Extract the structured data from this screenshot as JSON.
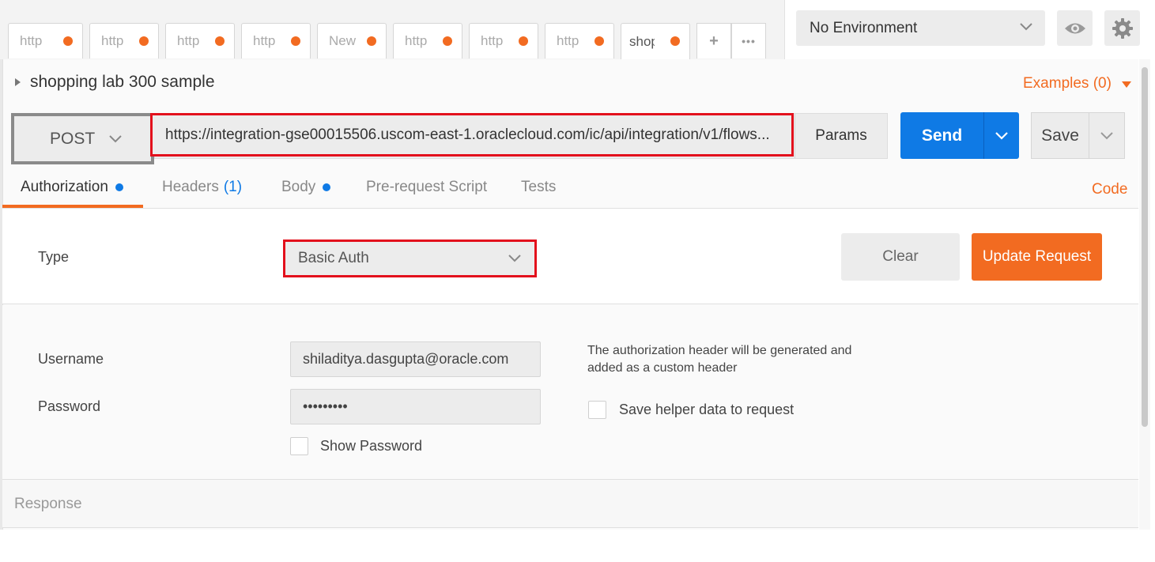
{
  "tabs": [
    {
      "label": "http",
      "unsaved": true
    },
    {
      "label": "http",
      "unsaved": true
    },
    {
      "label": "http",
      "unsaved": true
    },
    {
      "label": "http",
      "unsaved": true
    },
    {
      "label": "New",
      "unsaved": true
    },
    {
      "label": "http",
      "unsaved": true
    },
    {
      "label": "http",
      "unsaved": true
    },
    {
      "label": "http",
      "unsaved": true
    },
    {
      "label": "shop",
      "unsaved": true,
      "active": true
    }
  ],
  "tab_actions": {
    "add_glyph": "+",
    "more_glyph": "•••"
  },
  "environment": {
    "selected": "No Environment"
  },
  "icons": {
    "eye": "eye-icon",
    "settings": "gear-icon"
  },
  "request": {
    "name": "shopping lab 300 sample",
    "examples_label": "Examples (0)",
    "method": "POST",
    "url": "https://integration-gse00015506.uscom-east-1.oraclecloud.com/ic/api/integration/v1/flows...",
    "params_label": "Params",
    "send_label": "Send",
    "save_label": "Save"
  },
  "subtabs": {
    "authorization": "Authorization",
    "headers": "Headers",
    "headers_count": "(1)",
    "body": "Body",
    "prerequest": "Pre-request Script",
    "tests": "Tests",
    "code": "Code"
  },
  "auth": {
    "type_label": "Type",
    "type_value": "Basic Auth",
    "clear_label": "Clear",
    "update_label": "Update Request",
    "username_label": "Username",
    "username_value": "shiladitya.dasgupta@oracle.com",
    "password_label": "Password",
    "password_value": "•••••••••",
    "show_password_label": "Show Password",
    "help_text": "The authorization header will be generated and added as a custom header",
    "save_helper_label": "Save helper data to request"
  },
  "response": {
    "label": "Response"
  },
  "colors": {
    "accent": "#f26b21",
    "primary": "#0f7ae5",
    "highlight": "#e3101c"
  }
}
